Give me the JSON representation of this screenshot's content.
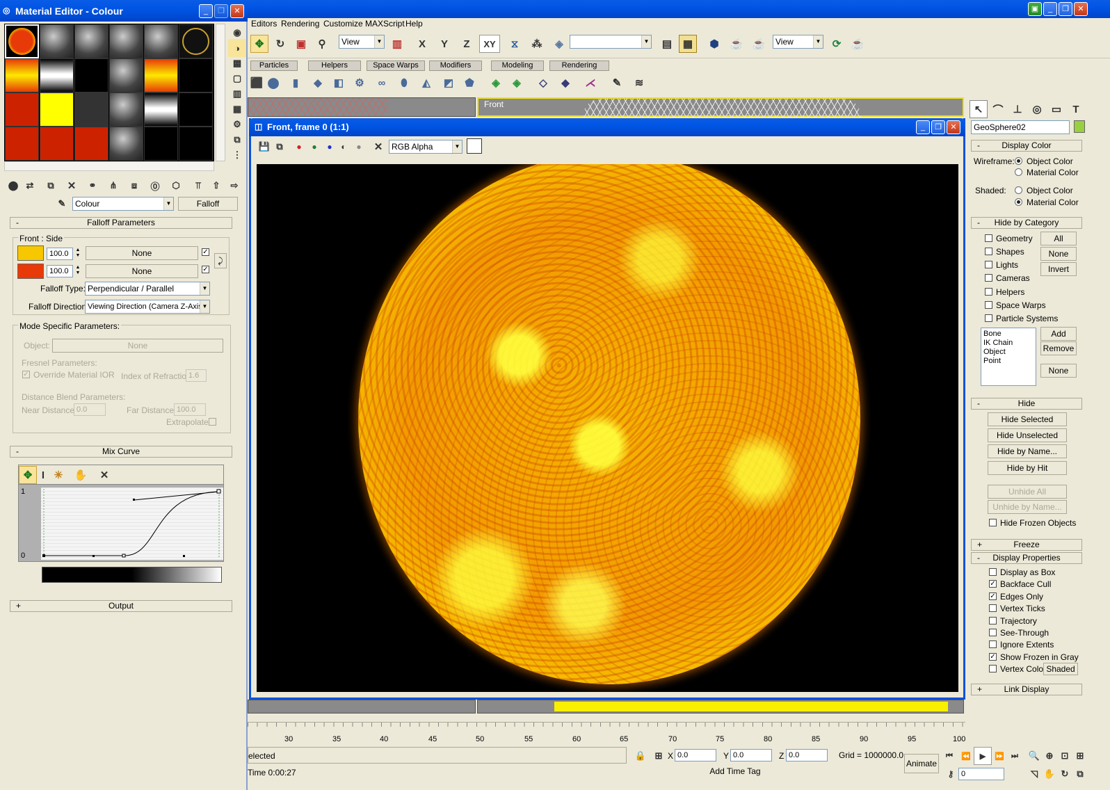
{
  "material_editor": {
    "title": "Material Editor - Colour",
    "map_name": "Colour",
    "map_type": "Falloff",
    "falloff_params": {
      "header": "Falloff Parameters",
      "front_side_label": "Front : Side",
      "color1_value": "100.0",
      "color1_map": "None",
      "color1_swatch": "#f7c800",
      "color2_value": "100.0",
      "color2_map": "None",
      "color2_swatch": "#e83a08",
      "falloff_type_label": "Falloff Type:",
      "falloff_type": "Perpendicular / Parallel",
      "falloff_direction_label": "Falloff Direction:",
      "falloff_direction": "Viewing Direction (Camera Z-Axis)"
    },
    "mode_specific": {
      "header": "Mode Specific Parameters:",
      "object_label": "Object:",
      "object_value": "None",
      "fresnel_label": "Fresnel Parameters:",
      "override_ior": "Override Material IOR",
      "ior_label": "Index of Refraction",
      "ior_value": "1.6",
      "distance_blend_label": "Distance Blend Parameters:",
      "near_label": "Near Distance:",
      "near_value": "0.0",
      "far_label": "Far Distance:",
      "far_value": "100.0",
      "extrapolate": "Extrapolate"
    },
    "mix_curve": {
      "header": "Mix Curve",
      "y_top": "1",
      "y_bottom": "0"
    },
    "output_header": "Output"
  },
  "main_menu": [
    "Editors",
    "Rendering",
    "Customize",
    "MAXScript",
    "Help"
  ],
  "toolbar": {
    "ref_coord": "View",
    "axis_x": "X",
    "axis_y": "Y",
    "axis_z": "Z",
    "axis_xy": "XY",
    "selection_set": "",
    "view2": "View"
  },
  "tabs": [
    "Particles",
    "Helpers",
    "Space Warps",
    "Modifiers",
    "Modeling",
    "Rendering"
  ],
  "viewport_label": "Front",
  "render_window": {
    "title": "Front, frame 0 (1:1)",
    "channel": "RGB Alpha"
  },
  "command_panel": {
    "object_name": "GeoSphere02",
    "display_color": {
      "header": "Display Color",
      "wireframe_label": "Wireframe:",
      "shaded_label": "Shaded:",
      "object_color": "Object Color",
      "material_color": "Material Color"
    },
    "hide_by_category": {
      "header": "Hide by Category",
      "items": [
        "Geometry",
        "Shapes",
        "Lights",
        "Cameras",
        "Helpers",
        "Space Warps",
        "Particle Systems"
      ],
      "btn_all": "All",
      "btn_none": "None",
      "btn_invert": "Invert",
      "list": [
        "Bone",
        "IK Chain Object",
        "Point"
      ],
      "btn_add": "Add",
      "btn_remove": "Remove",
      "btn_none2": "None"
    },
    "hide": {
      "header": "Hide",
      "hide_selected": "Hide Selected",
      "hide_unselected": "Hide Unselected",
      "hide_by_name": "Hide by Name...",
      "hide_by_hit": "Hide by Hit",
      "unhide_all": "Unhide All",
      "unhide_by_name": "Unhide by Name...",
      "hide_frozen": "Hide Frozen Objects"
    },
    "freeze_header": "Freeze",
    "display_properties": {
      "header": "Display Properties",
      "items": [
        {
          "label": "Display as Box",
          "checked": false
        },
        {
          "label": "Backface Cull",
          "checked": true
        },
        {
          "label": "Edges Only",
          "checked": true
        },
        {
          "label": "Vertex Ticks",
          "checked": false
        },
        {
          "label": "Trajectory",
          "checked": false
        },
        {
          "label": "See-Through",
          "checked": false
        },
        {
          "label": "Ignore Extents",
          "checked": false
        },
        {
          "label": "Show Frozen in Gray",
          "checked": true
        },
        {
          "label": "Vertex Colors",
          "checked": false
        }
      ],
      "shaded_btn": "Shaded"
    },
    "link_display_header": "Link Display"
  },
  "timeline": {
    "ticks": [
      "30",
      "35",
      "40",
      "45",
      "50",
      "55",
      "60",
      "65",
      "70",
      "75",
      "80",
      "85",
      "90",
      "95",
      "100"
    ]
  },
  "status": {
    "selected_text": "elected",
    "time_text": "Time  0:00:27",
    "x_label": "X",
    "x_value": "0.0",
    "y_label": "Y",
    "y_value": "0.0",
    "z_label": "Z",
    "z_value": "0.0",
    "grid": "Grid = 1000000.0",
    "animate": "Animate",
    "add_time_tag": "Add Time Tag",
    "frame": "0"
  }
}
